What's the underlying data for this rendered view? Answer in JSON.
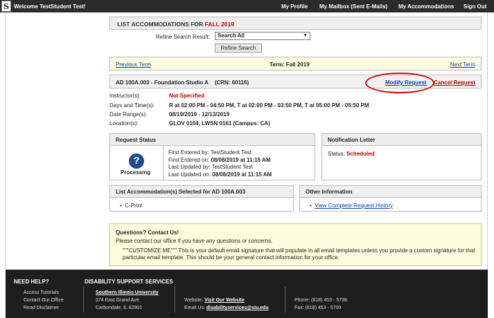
{
  "topbar": {
    "logo_glyph": "S",
    "welcome": "Welcome TestStudent Test!",
    "nav": [
      "My Profile",
      "My Mailbox (Sent E-Mails)",
      "My Accommodations",
      "Sign Out"
    ]
  },
  "page": {
    "title_prefix": "LIST ACCOMMODATIONS FOR",
    "title_term": "FALL 2019",
    "refine_label": "Refine Search Result:",
    "refine_value": "Search All",
    "refine_button": "Refine Search"
  },
  "term_nav": {
    "prev": "Previous Term",
    "current": "Term: Fall 2019",
    "next": "Next Term"
  },
  "course": {
    "name": "AD 100A.003 - Foundation Studio A",
    "crn_label": "(CRN:",
    "crn": "60116)",
    "modify": "Modify Request",
    "cancel": "Cancel Request"
  },
  "details": {
    "instructor_label": "Instructor(s):",
    "instructor": "Not Specified",
    "days_label": "Days and Time(s):",
    "days": "R at 02:00 PM - 04:50 PM, T at 02:00 PM - 03:50 PM, T at 05:00 PM - 05:50 PM",
    "range_label": "Date Range(s):",
    "range": "08/19/2019 - 12/13/2019",
    "location_label": "Location(s):",
    "location": "GLOV 0104, LWSN 0161 (Campus: CA)"
  },
  "request_status": {
    "header": "Request Status",
    "icon_glyph": "?",
    "status": "Processing",
    "first_entered_by_label": "First Entered by:",
    "first_entered_by": "TestStudent Test",
    "first_entered_on_label": "First Entered on:",
    "first_entered_on": "08/08/2019 at 11:15 AM",
    "last_updated_by_label": "Last Updated by:",
    "last_updated_by": "TestStudent Test",
    "last_updated_on_label": "Last Updated on:",
    "last_updated_on": "08/08/2019 at 11:15 AM"
  },
  "notification": {
    "header": "Notification Letter",
    "status_label": "Status:",
    "status": "Scheduled"
  },
  "accommodations": {
    "header": "List Accommodation(s) Selected for AD 100A.003",
    "items": [
      "C-Print"
    ]
  },
  "other_info": {
    "header": "Other Information",
    "link": "View Complete Request History"
  },
  "questions": {
    "title": "Questions? Contact Us!",
    "line1": "Please contact our office if you have any questions or concerns.",
    "line2": "\"\"\"CUSTOMIZE ME\"\"\" This is your default email signature that will populate in all email templates unless you provide a custom signature for that particular email template. This should be your general contact information for your office."
  },
  "footer": {
    "need_help": "NEED HELP?",
    "help_links": [
      "Access Tutorials",
      "Contact Our Office",
      "Read Disclaimer"
    ],
    "dss_title": "DISABILITY SUPPORT SERVICES",
    "university": "Southern Illinois University",
    "address1": "374 East Grand Ave.",
    "address2": "Carbondale, IL 62901",
    "website_label": "Website:",
    "website": "Visit Our Website",
    "email_label": "Email Us:",
    "email": "disabilityservices@siu.edu",
    "phone": "Phone: (618) 453 - 5738",
    "fax": "Fax: (618) 453 - 5700"
  }
}
